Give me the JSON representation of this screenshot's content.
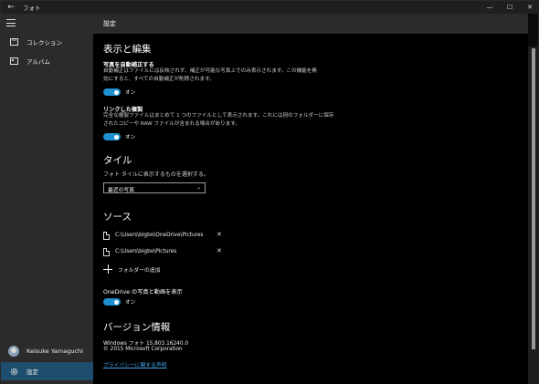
{
  "window": {
    "title": "フォト",
    "back_icon": "back-arrow-icon",
    "controls": [
      "—",
      "☐",
      "✕"
    ]
  },
  "sidebar": {
    "items": [
      {
        "label": "コレクション",
        "icon": "collection-icon"
      },
      {
        "label": "アルバム",
        "icon": "album-icon"
      }
    ],
    "user": {
      "name": "Keisuke Yamaguchi"
    },
    "settings": {
      "label": "設定",
      "icon": "gear-icon"
    }
  },
  "main": {
    "page_title": "設定",
    "display_edit": {
      "heading": "表示と編集",
      "auto_enhance": {
        "title": "写真を自動補正する",
        "desc_1": "自動補正はファイルには反映されず、補正が可能な写真上でのみ表示されます。この機能を無",
        "desc_2": "効にすると、すべての自動補正が削除されます。",
        "toggle": "オン"
      },
      "linked_duplicates": {
        "title": "リンクした複製",
        "desc_1": "完全な複製ファイルはまとめて 1 つのファイルとして表示されます。これには別のフォルダーに保存",
        "desc_2": "されたコピーや RAW ファイルが含まれる場合があります。",
        "toggle": "オン"
      }
    },
    "tile": {
      "heading": "タイル",
      "prompt": "フォト タイルに表示するものを選択する。",
      "selected": "最近の写真"
    },
    "sources": {
      "heading": "ソース",
      "folders": [
        "C:\\Users\\bigbo\\OneDrive\\Pictures",
        "C:\\Users\\bigbo\\Pictures"
      ],
      "add_label": "フォルダーの追加",
      "onedrive_title": "OneDrive の写真と動画を表示",
      "onedrive_toggle": "オン"
    },
    "about": {
      "heading": "バージョン情報",
      "version": "Windows フォト 15.803.16240.0",
      "copyright": "© 2015 Microsoft Corporation",
      "privacy_link": "プライバシーに関する声明"
    }
  },
  "colors": {
    "accent": "#1e8fd0",
    "link": "#3ea3e8",
    "selected_nav": "#1e4e6e"
  }
}
